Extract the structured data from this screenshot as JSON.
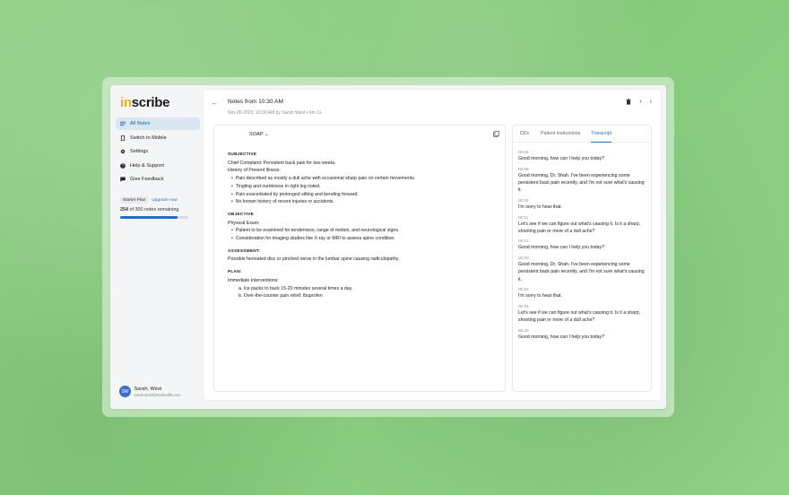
{
  "sidebar": {
    "logo_prefix": "in",
    "logo_suffix": "scribe",
    "items": [
      {
        "label": "All Notes",
        "icon": "list-icon"
      },
      {
        "label": "Switch to Mobile",
        "icon": "phone-icon"
      },
      {
        "label": "Settings",
        "icon": "gear-icon"
      },
      {
        "label": "Help & Support",
        "icon": "help-icon"
      },
      {
        "label": "Give Feedback",
        "icon": "feedback-icon"
      }
    ],
    "plan": {
      "badge": "Starter Plan",
      "upgrade": "Upgrade now",
      "count": "254",
      "count_suffix": "of 300 notes remaining",
      "progress": 0.847
    },
    "user": {
      "initials": "SW",
      "name": "Sarah, West",
      "email": "sarah.west@starhealth.com"
    }
  },
  "header": {
    "title": "Notes from 10:30 AM",
    "meta": "Nov 26 2023, 10:30 AM by Sarah West • 6m 1s"
  },
  "note": {
    "template": "SOAP",
    "subjective": {
      "heading": "SUBJECTIVE",
      "chief": "Chief Complaint: Persistent back pain for two weeks.",
      "hpi": "History of Present Illness:",
      "bullets": [
        "Pain described as mostly a dull ache with occasional sharp pain on certain movements.",
        "Tingling and numbness in right leg noted.",
        "Pain exacerbated by prolonged sitting and bending forward.",
        "No known history of recent injuries or accidents."
      ]
    },
    "objective": {
      "heading": "OBJECTIVE",
      "exam": "Physical Exam:",
      "bullets": [
        "Patient to be examined for tenderness, range of motion, and neurological signs.",
        "Consideration for imaging studies like X-ray or MRI to assess spine condition."
      ]
    },
    "assessment": {
      "heading": "ASSESSMENT:",
      "text": "Possible herniated disc or pinched nerve in the lumbar spine causing radiculopathy."
    },
    "plan": {
      "heading": "PLAN:",
      "intro": "Immediate Interventions:",
      "items": [
        "a. Ice packs to back 15-20 minutes several times a day.",
        "b. Over-the-counter pain relief: Ibuprofen"
      ]
    }
  },
  "side_panel": {
    "tabs": [
      "DDx",
      "Patient Instructions",
      "Transcript"
    ],
    "transcript": [
      {
        "time": "00:04",
        "text": "Good morning, how can I help you today?"
      },
      {
        "time": "00:09",
        "text": "Good morning, Dr. Shah. I've been experiencing some persistent back pain recently, and I'm not sure what's causing it."
      },
      {
        "time": "00:09",
        "text": "I'm sorry to hear that."
      },
      {
        "time": "00:11",
        "text": "Let's see if we can figure out what's causing it. Is it a sharp, shooting pain or more of a dull ache?"
      },
      {
        "time": "00:13",
        "text": "Good morning, how can I help you today?"
      },
      {
        "time": "00:20",
        "text": "Good morning, Dr. Shah. I've been experiencing some persistent back pain recently, and I'm not sure what's causing it."
      },
      {
        "time": "00:22",
        "text": "I'm sorry to hear that."
      },
      {
        "time": "00:25",
        "text": "Let's see if we can figure out what's causing it. Is it a sharp, shooting pain or more of a dull ache?"
      },
      {
        "time": "00:30",
        "text": "Good morning, how can I help you today?"
      }
    ]
  },
  "colors": {
    "background": "#8fcf85",
    "accent": "#1f6fc4",
    "logo_accent": "#f2b21b"
  }
}
